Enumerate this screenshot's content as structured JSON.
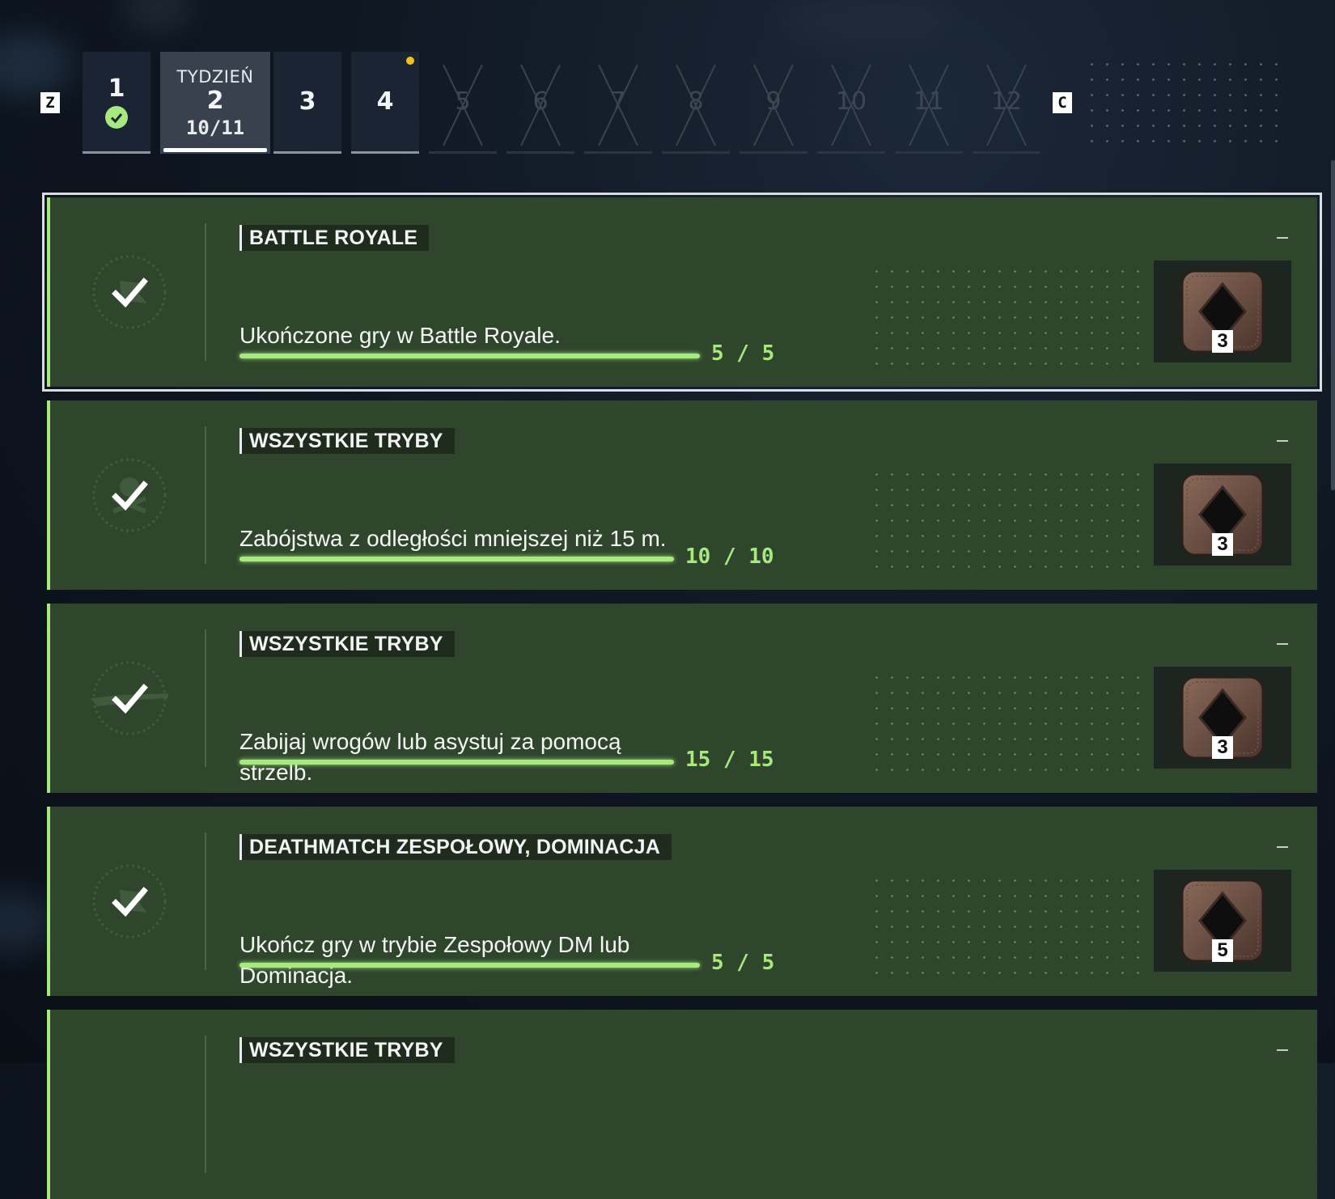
{
  "nav": {
    "prev_key": "Z",
    "next_key": "C",
    "weeks": [
      {
        "number": "1",
        "state": "completed"
      },
      {
        "number": "2",
        "state": "active",
        "prefix": "TYDZIEŃ",
        "progress": "10/11"
      },
      {
        "number": "3",
        "state": "available"
      },
      {
        "number": "4",
        "state": "available",
        "new_indicator": true
      },
      {
        "number": "5",
        "state": "locked"
      },
      {
        "number": "6",
        "state": "locked"
      },
      {
        "number": "7",
        "state": "locked"
      },
      {
        "number": "8",
        "state": "locked"
      },
      {
        "number": "9",
        "state": "locked"
      },
      {
        "number": "10",
        "state": "locked"
      },
      {
        "number": "11",
        "state": "locked"
      },
      {
        "number": "12",
        "state": "locked"
      }
    ]
  },
  "challenges": [
    {
      "mode": "BATTLE ROYALE",
      "description": "Ukończone gry w Battle Royale.",
      "progress_text": "5 / 5",
      "progress": 1.0,
      "reward_count": "3",
      "icon": "flag-icon",
      "collapse": "–"
    },
    {
      "mode": "WSZYSTKIE TRYBY",
      "description": "Zabójstwa z odległości mniejszej niż 15 m.",
      "progress_text": "10 / 10",
      "progress": 1.0,
      "reward_count": "3",
      "icon": "skull-crossbones-icon",
      "collapse": "–"
    },
    {
      "mode": "WSZYSTKIE TRYBY",
      "description": "Zabijaj wrogów lub asystuj za pomocą strzelb.",
      "progress_text": "15 / 15",
      "progress": 1.0,
      "reward_count": "3",
      "icon": "shotgun-icon",
      "collapse": "–"
    },
    {
      "mode": "DEATHMATCH ZESPOŁOWY, DOMINACJA",
      "description": "Ukończ gry w trybie Zespołowy DM lub Dominacja.",
      "progress_text": "5 / 5",
      "progress": 1.0,
      "reward_count": "5",
      "icon": "flag-icon",
      "collapse": "–"
    },
    {
      "mode": "WSZYSTKIE TRYBY",
      "collapse": "–"
    }
  ],
  "colors": {
    "accent_green": "#a6e97e",
    "card_bg": "#2f462d",
    "new_dot": "#f2c21b"
  }
}
